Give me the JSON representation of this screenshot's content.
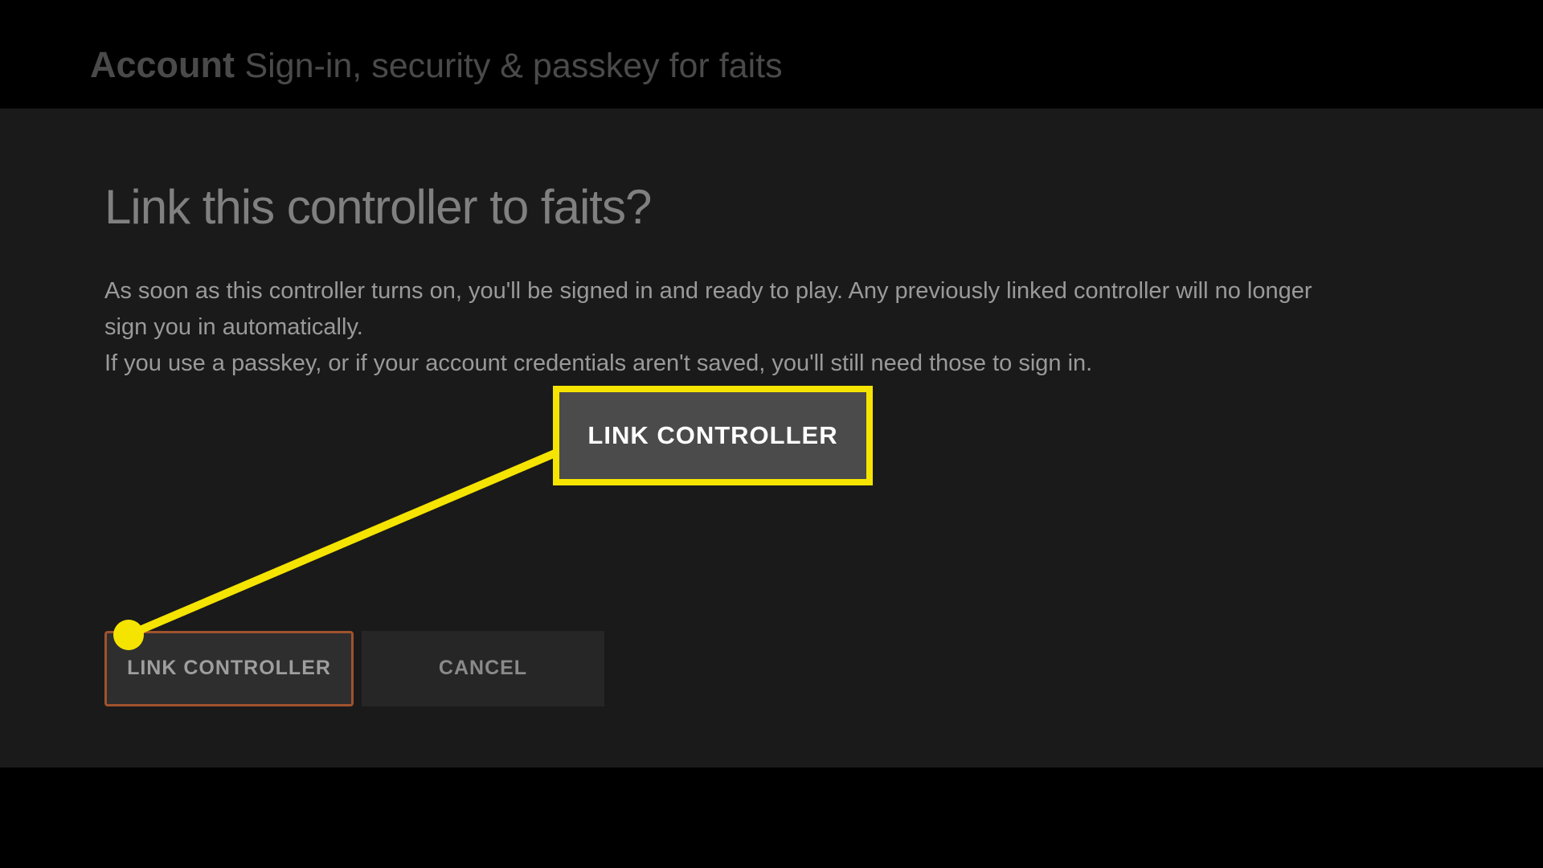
{
  "header": {
    "account_label": "Account",
    "subtitle": "Sign-in, security & passkey for faits"
  },
  "dialog": {
    "title": "Link this controller to faits?",
    "body_line1": "As soon as this controller turns on, you'll be signed in and ready to play. Any previously linked controller will no longer sign you in automatically.",
    "body_line2": "If you use a passkey, or if your account credentials aren't saved, you'll still need those to sign in."
  },
  "buttons": {
    "link_controller": "LINK CONTROLLER",
    "cancel": "CANCEL"
  },
  "annotation": {
    "callout_label": "LINK CONTROLLER",
    "highlight_color": "#f5e400"
  }
}
